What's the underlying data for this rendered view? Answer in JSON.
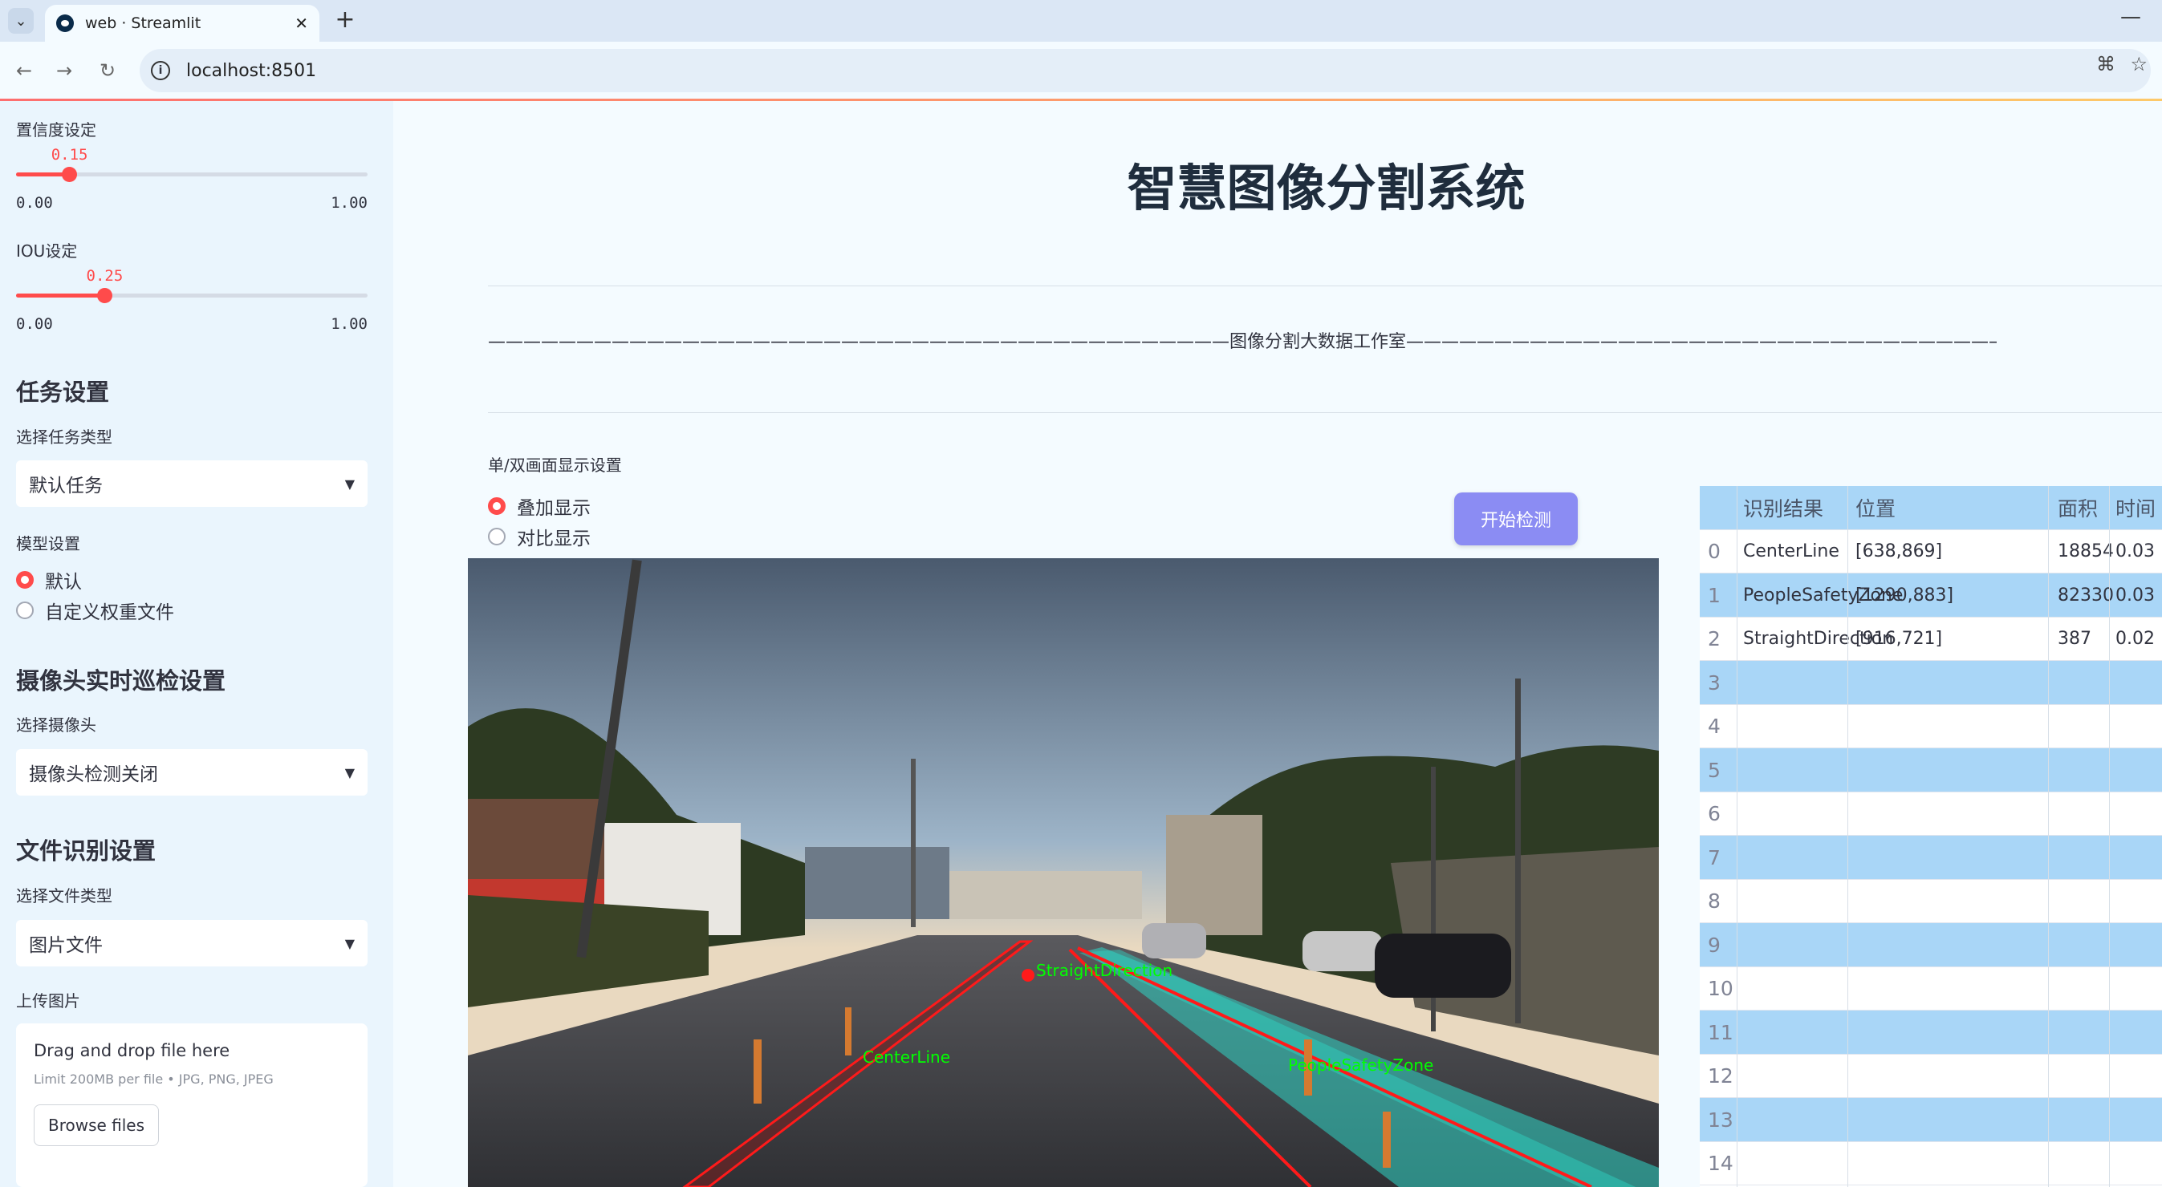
{
  "browser": {
    "tab_title": "web · Streamlit",
    "url": "localhost:8501"
  },
  "sidebar": {
    "confidence": {
      "label": "置信度设定",
      "value": "0.15",
      "value_num": 0.15,
      "min": "0.00",
      "max": "1.00"
    },
    "iou": {
      "label": "IOU设定",
      "value": "0.25",
      "value_num": 0.25,
      "min": "0.00",
      "max": "1.00"
    },
    "task_heading": "任务设置",
    "task_type_label": "选择任务类型",
    "task_type_value": "默认任务",
    "model_label": "模型设置",
    "model_options": [
      "默认",
      "自定义权重文件"
    ],
    "model_selected": "默认",
    "camera_heading": "摄像头实时巡检设置",
    "camera_label": "选择摄像头",
    "camera_value": "摄像头检测关闭",
    "file_heading": "文件识别设置",
    "file_type_label": "选择文件类型",
    "file_type_value": "图片文件",
    "upload_label": "上传图片",
    "upload_title": "Drag and drop file here",
    "upload_limit": "Limit 200MB per file • JPG, PNG, JPEG",
    "browse_label": "Browse files"
  },
  "main": {
    "title": "智慧图像分割系统",
    "studio_line": "——————————————————————————————————————————图像分割大数据工作室——————————————————————————————————————————",
    "display_label": "单/双画面显示设置",
    "display_options": [
      "叠加显示",
      "对比显示"
    ],
    "display_selected": "叠加显示",
    "start_button": "开始检测"
  },
  "image_labels": {
    "center_line": "CenterLine",
    "straight_direction": "StraightDirection",
    "people_safety_zone": "PeopleSafetyZone"
  },
  "results_table": {
    "headers": [
      "识别结果",
      "位置",
      "面积",
      "时间"
    ],
    "rows": [
      {
        "index": "0",
        "result": "CenterLine",
        "position": "[638,869]",
        "area": "18854",
        "time": "0.03"
      },
      {
        "index": "1",
        "result": "PeopleSafetyZone",
        "position": "[1290,883]",
        "area": "82330",
        "time": "0.03"
      },
      {
        "index": "2",
        "result": "StraightDirection",
        "position": "[916,721]",
        "area": "387",
        "time": "0.02"
      },
      {
        "index": "3"
      },
      {
        "index": "4"
      },
      {
        "index": "5"
      },
      {
        "index": "6"
      },
      {
        "index": "7"
      },
      {
        "index": "8"
      },
      {
        "index": "9"
      },
      {
        "index": "10"
      },
      {
        "index": "11"
      },
      {
        "index": "12"
      },
      {
        "index": "13"
      },
      {
        "index": "14"
      }
    ]
  },
  "colors": {
    "accent": "#ff4b4b",
    "button": "#8b8cf3",
    "table_stripe": "#a9d6f7",
    "sidebar_bg": "#eaf5fd",
    "mask_red": "#ff1a1a",
    "mask_green": "#00ff00",
    "mask_cyan": "#2fd6c6"
  }
}
